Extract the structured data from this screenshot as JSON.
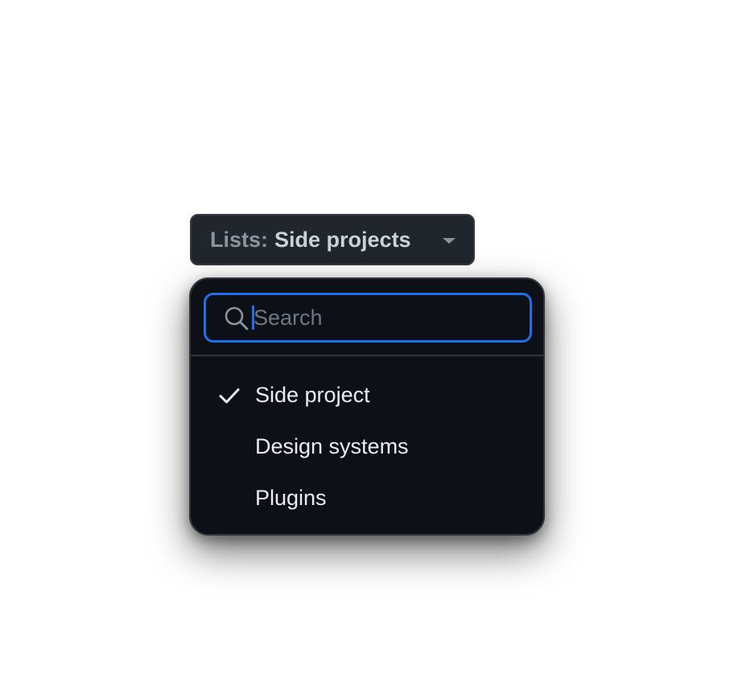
{
  "list_button": {
    "prefix": "Lists:",
    "value": "Side projects",
    "caret_icon": "triangle-down-icon"
  },
  "search": {
    "placeholder": "Search",
    "value": "",
    "icon": "search-icon"
  },
  "options": [
    {
      "label": "Side project",
      "selected": true
    },
    {
      "label": "Design systems",
      "selected": false
    },
    {
      "label": "Plugins",
      "selected": false
    }
  ],
  "colors": {
    "menu_background": "#0d1117",
    "button_background": "#21262d",
    "focus_ring": "#1f6feb",
    "text_primary": "#e6edf3",
    "text_muted": "#8b949e",
    "border": "#30363d"
  }
}
